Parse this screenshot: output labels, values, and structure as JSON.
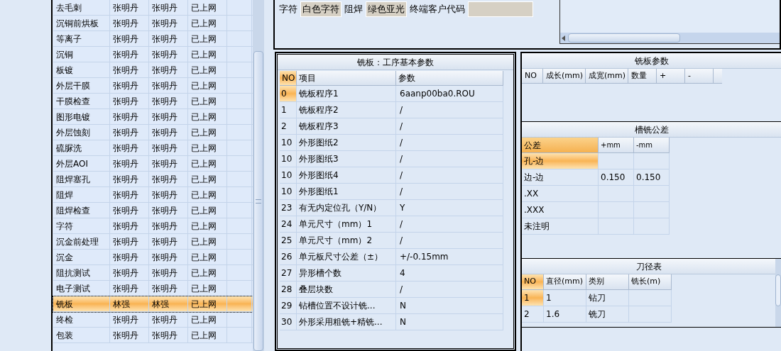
{
  "process_list": {
    "rows": [
      {
        "cells": [
          "去毛刺",
          "张明丹",
          "张明丹",
          "已上网"
        ],
        "selected": false
      },
      {
        "cells": [
          "沉铜前烘板",
          "张明丹",
          "张明丹",
          "已上网"
        ],
        "selected": false
      },
      {
        "cells": [
          "等离子",
          "张明丹",
          "张明丹",
          "已上网"
        ],
        "selected": false
      },
      {
        "cells": [
          "沉铜",
          "张明丹",
          "张明丹",
          "已上网"
        ],
        "selected": false
      },
      {
        "cells": [
          "板镀",
          "张明丹",
          "张明丹",
          "已上网"
        ],
        "selected": false
      },
      {
        "cells": [
          "外层干膜",
          "张明丹",
          "张明丹",
          "已上网"
        ],
        "selected": false
      },
      {
        "cells": [
          "干膜检查",
          "张明丹",
          "张明丹",
          "已上网"
        ],
        "selected": false
      },
      {
        "cells": [
          "图形电镀",
          "张明丹",
          "张明丹",
          "已上网"
        ],
        "selected": false
      },
      {
        "cells": [
          "外层蚀刻",
          "张明丹",
          "张明丹",
          "已上网"
        ],
        "selected": false
      },
      {
        "cells": [
          "硫脲洗",
          "张明丹",
          "张明丹",
          "已上网"
        ],
        "selected": false
      },
      {
        "cells": [
          "外层AOI",
          "张明丹",
          "张明丹",
          "已上网"
        ],
        "selected": false
      },
      {
        "cells": [
          "阻焊塞孔",
          "张明丹",
          "张明丹",
          "已上网"
        ],
        "selected": false
      },
      {
        "cells": [
          "阻焊",
          "张明丹",
          "张明丹",
          "已上网"
        ],
        "selected": false
      },
      {
        "cells": [
          "阻焊检查",
          "张明丹",
          "张明丹",
          "已上网"
        ],
        "selected": false
      },
      {
        "cells": [
          "字符",
          "张明丹",
          "张明丹",
          "已上网"
        ],
        "selected": false
      },
      {
        "cells": [
          "沉金前处理",
          "张明丹",
          "张明丹",
          "已上网"
        ],
        "selected": false
      },
      {
        "cells": [
          "沉金",
          "张明丹",
          "张明丹",
          "已上网"
        ],
        "selected": false
      },
      {
        "cells": [
          "阻抗测试",
          "张明丹",
          "张明丹",
          "已上网"
        ],
        "selected": false
      },
      {
        "cells": [
          "电子测试",
          "张明丹",
          "张明丹",
          "已上网"
        ],
        "selected": false
      },
      {
        "cells": [
          "铣板",
          "林强",
          "林强",
          "已上网"
        ],
        "selected": true
      },
      {
        "cells": [
          "终检",
          "张明丹",
          "张明丹",
          "已上网"
        ],
        "selected": false
      },
      {
        "cells": [
          "包装",
          "张明丹",
          "张明丹",
          "已上网"
        ],
        "selected": false
      }
    ]
  },
  "info_fields": [
    {
      "label": "字符",
      "value": "白色字符"
    },
    {
      "label": "阻焊",
      "value": "绿色亚光"
    },
    {
      "label": "终端客户代码"
    }
  ],
  "basic_params": {
    "title": "铣板：工序基本参数",
    "columns": [
      "NO",
      "项目",
      "参数"
    ],
    "rows": [
      {
        "no": "0",
        "item": "铣板程序1",
        "value": "6aanp00ba0.ROU",
        "selected": true
      },
      {
        "no": "1",
        "item": "铣板程序2",
        "value": "/",
        "selected": false
      },
      {
        "no": "2",
        "item": "铣板程序3",
        "value": "/",
        "selected": false
      },
      {
        "no": "10",
        "item": "外形图纸2",
        "value": "/",
        "selected": false
      },
      {
        "no": "10",
        "item": "外形图纸3",
        "value": "/",
        "selected": false
      },
      {
        "no": "10",
        "item": "外形图纸4",
        "value": "/",
        "selected": false
      },
      {
        "no": "10",
        "item": "外形图纸1",
        "value": "/",
        "selected": false
      },
      {
        "no": "23",
        "item": "有无内定位孔（Y/N）",
        "value": "Y",
        "selected": false
      },
      {
        "no": "24",
        "item": "单元尺寸（mm）1",
        "value": "/",
        "selected": false
      },
      {
        "no": "25",
        "item": "单元尺寸（mm）2",
        "value": "/",
        "selected": false
      },
      {
        "no": "26",
        "item": "单元板尺寸公差（±）",
        "value": "+/-0.15mm",
        "selected": false
      },
      {
        "no": "27",
        "item": "异形槽个数",
        "value": "4",
        "selected": false
      },
      {
        "no": "28",
        "item": "叠层块数",
        "value": "/",
        "selected": false
      },
      {
        "no": "29",
        "item": "钻槽位置不设计铣...",
        "value": "N",
        "selected": false
      },
      {
        "no": "30",
        "item": "外形采用粗铣+精铣...",
        "value": "N",
        "selected": false
      }
    ]
  },
  "mill_params": {
    "title": "铣板参数",
    "columns": [
      "NO",
      "成长(mm)",
      "成宽(mm)",
      "数量",
      "+",
      "-"
    ]
  },
  "slot_tolerance": {
    "title": "槽铣公差",
    "columns": [
      {
        "label": "公差",
        "selected": true
      },
      {
        "label": "+mm",
        "selected": false
      },
      {
        "label": "-mm",
        "selected": false
      }
    ],
    "rows": [
      {
        "cells": [
          "孔-边",
          "",
          ""
        ],
        "selected": true
      },
      {
        "cells": [
          "边-边",
          "0.150",
          "0.150"
        ],
        "selected": false
      },
      {
        "cells": [
          ".XX",
          "",
          ""
        ],
        "selected": false
      },
      {
        "cells": [
          ".XXX",
          "",
          ""
        ],
        "selected": false
      },
      {
        "cells": [
          "未注明",
          "",
          ""
        ],
        "selected": false
      }
    ]
  },
  "tool_table": {
    "title": "刀径表",
    "columns": [
      "NO",
      "直径(mm)",
      "类别",
      "铣长(m)"
    ],
    "rows": [
      {
        "cells": [
          "1",
          "1",
          "钻刀",
          ""
        ],
        "selected": true
      },
      {
        "cells": [
          "2",
          "1.6",
          "铣刀",
          ""
        ],
        "selected": false
      }
    ]
  }
}
